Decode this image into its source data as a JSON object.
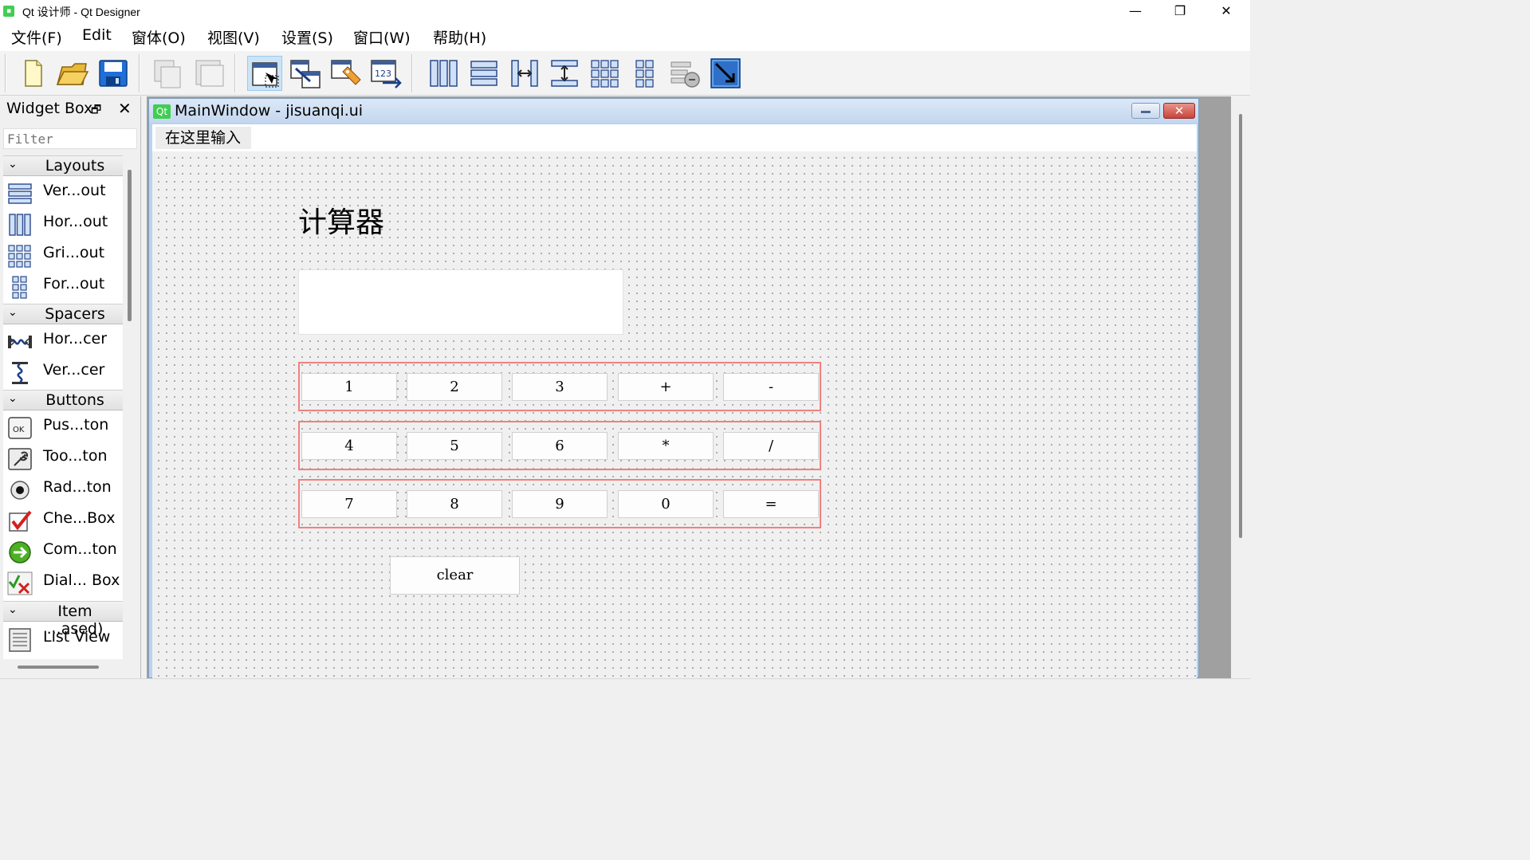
{
  "window": {
    "title": "Qt 设计师 - Qt Designer",
    "app_icon": "Qt",
    "minimize": "—",
    "maximize": "❐",
    "close": "✕"
  },
  "menubar": {
    "items": [
      "文件(F)",
      "Edit",
      "窗体(O)",
      "视图(V)",
      "设置(S)",
      "窗口(W)",
      "帮助(H)"
    ]
  },
  "toolbar": {
    "icons": [
      "new-file-icon",
      "open-folder-icon",
      "save-icon",
      "copy-icon",
      "paste-icon",
      "edit-widgets-icon",
      "edit-signals-slots-icon",
      "edit-buddies-icon",
      "edit-tab-order-icon",
      "layout-horizontal-icon",
      "layout-vertical-icon",
      "layout-horizontal-splitter-icon",
      "layout-vertical-splitter-icon",
      "layout-grid-icon",
      "layout-form-icon",
      "break-layout-icon",
      "adjust-size-icon"
    ],
    "active": "edit-widgets-icon"
  },
  "widget_box": {
    "title": "Widget Box",
    "float": "🗗",
    "close": "✕",
    "filter_placeholder": "Filter",
    "categories": [
      {
        "label": "Layouts",
        "items": [
          "Ver...out",
          "Hor...out",
          "Gri...out",
          "For...out"
        ]
      },
      {
        "label": "Spacers",
        "items": [
          "Hor...cer",
          "Ver...cer"
        ]
      },
      {
        "label": "Buttons",
        "items": [
          "Pus...ton",
          "Too...ton",
          "Rad...ton",
          "Che...Box",
          "Com...ton",
          "Dial... Box"
        ]
      },
      {
        "label": "Item ...ased)",
        "items": [
          "List View"
        ]
      }
    ],
    "chevron": "⌄"
  },
  "form": {
    "title": "MainWindow - jisuanqi.ui",
    "icon_text": "Qt",
    "close_glyph": "✕",
    "menu_placeholder": "在这里输入",
    "heading": "计算器",
    "display_value": "",
    "rows": [
      [
        "1",
        "2",
        "3",
        "+",
        "-"
      ],
      [
        "4",
        "5",
        "6",
        "*",
        "/"
      ],
      [
        "7",
        "8",
        "9",
        "0",
        "="
      ]
    ],
    "clear_label": "clear",
    "layout_border_color": "#f08080"
  }
}
